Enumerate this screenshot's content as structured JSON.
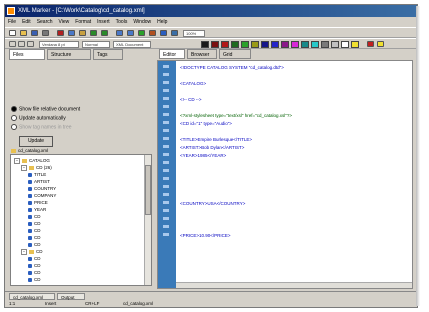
{
  "window": {
    "title": "XML Marker - [C:\\Work\\Catalog\\cd_catalog.xml]"
  },
  "menu": [
    "File",
    "Edit",
    "Search",
    "View",
    "Format",
    "Insert",
    "Tools",
    "Window",
    "Help"
  ],
  "toolbar": {
    "zoom_value": "100%",
    "font_combo": "Verdana 8 pt",
    "style_combo": "Normal",
    "xml_combo": "XML Document",
    "palette": [
      "#1a1a1a",
      "#7a1010",
      "#b01818",
      "#1e6a1e",
      "#2aa02a",
      "#9a9a18",
      "#16168a",
      "#2424c8",
      "#8a188a",
      "#d828d8",
      "#188a8a",
      "#28c8c8",
      "#7a7a7a",
      "#c0c0c0",
      "#ffffff",
      "#f0e030"
    ]
  },
  "left_panel": {
    "tabs": [
      "Files",
      "Structure",
      "Tags"
    ],
    "options": [
      {
        "label": "Show file relative document",
        "selected": true,
        "dim": false
      },
      {
        "label": "Update automatically",
        "selected": false,
        "dim": false
      },
      {
        "label": "Show tag names in tree",
        "selected": false,
        "dim": true
      }
    ],
    "update_button": "Update",
    "tree_header": "cd_catalog.xml",
    "tree": [
      {
        "label": "CATALOG",
        "level": 0,
        "kind": "folder",
        "expanded": true
      },
      {
        "label": "CD (26)",
        "level": 1,
        "kind": "folder",
        "expanded": true
      },
      {
        "label": "TITLE",
        "level": 2,
        "kind": "node"
      },
      {
        "label": "ARTIST",
        "level": 2,
        "kind": "node"
      },
      {
        "label": "COUNTRY",
        "level": 2,
        "kind": "node"
      },
      {
        "label": "COMPANY",
        "level": 2,
        "kind": "node"
      },
      {
        "label": "PRICE",
        "level": 2,
        "kind": "node"
      },
      {
        "label": "YEAR",
        "level": 2,
        "kind": "node"
      },
      {
        "label": "CD",
        "level": 2,
        "kind": "node"
      },
      {
        "label": "CD",
        "level": 2,
        "kind": "node"
      },
      {
        "label": "CD",
        "level": 2,
        "kind": "node"
      },
      {
        "label": "CD",
        "level": 2,
        "kind": "node"
      },
      {
        "label": "CD",
        "level": 2,
        "kind": "node"
      },
      {
        "label": "CD",
        "level": 1,
        "kind": "folder",
        "expanded": true
      },
      {
        "label": "CD",
        "level": 2,
        "kind": "node"
      },
      {
        "label": "CD",
        "level": 2,
        "kind": "node"
      },
      {
        "label": "CD",
        "level": 2,
        "kind": "node"
      },
      {
        "label": "CD",
        "level": 2,
        "kind": "node"
      }
    ]
  },
  "editor": {
    "tabs": [
      "Editor",
      "Browser",
      "Grid"
    ],
    "active_tab": "Editor",
    "lines": [
      {
        "text": "<!DOCTYPE CATALOG SYSTEM \"cd_catalog.dtd\">",
        "ok": false
      },
      {
        "text": "",
        "ok": false
      },
      {
        "text": "<CATALOG>",
        "ok": false
      },
      {
        "text": "",
        "ok": false
      },
      {
        "text": "<!-- CD -->",
        "ok": false
      },
      {
        "text": "",
        "ok": false
      },
      {
        "text": "<?xml-stylesheet type=\"text/xsl\" href=\"cd_catalog.xsl\"?>",
        "ok": true
      },
      {
        "text": "<CD id=\"1\" type=\"Audio\">",
        "ok": false
      },
      {
        "text": "",
        "ok": false
      },
      {
        "text": "<TITLE>Empire Burlesque</TITLE>",
        "ok": false
      },
      {
        "text": "<ARTIST>Bob Dylan</ARTIST>",
        "ok": false
      },
      {
        "text": "<YEAR>1985</YEAR>",
        "ok": false
      },
      {
        "text": "",
        "ok": false
      },
      {
        "text": "",
        "ok": false
      },
      {
        "text": "",
        "ok": false
      },
      {
        "text": "",
        "ok": false
      },
      {
        "text": "",
        "ok": false
      },
      {
        "text": "<COUNTRY>USA</COUNTRY>",
        "ok": false
      },
      {
        "text": "",
        "ok": false
      },
      {
        "text": "",
        "ok": false
      },
      {
        "text": "",
        "ok": false
      },
      {
        "text": "<PRICE>10.90</PRICE>",
        "ok": false
      }
    ]
  },
  "statusbar": {
    "tabs": [
      "cd_catalog.xml",
      "Output"
    ],
    "cells": [
      "1:1",
      "Insert",
      "CR+LF",
      "cd_catalog.xml"
    ]
  }
}
